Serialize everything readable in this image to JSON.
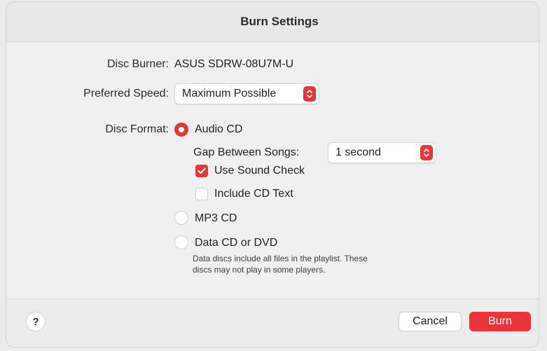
{
  "window": {
    "title": "Burn Settings"
  },
  "settings": {
    "disc_burner_label": "Disc Burner:",
    "disc_burner_value": "ASUS SDRW-08U7M-U",
    "preferred_speed_label": "Preferred Speed:",
    "preferred_speed_value": "Maximum Possible",
    "disc_format_label": "Disc Format:",
    "formats": [
      {
        "label": "Audio CD",
        "selected": true
      },
      {
        "label": "MP3 CD",
        "selected": false
      },
      {
        "label": "Data CD or DVD",
        "selected": false
      }
    ],
    "gap_label": "Gap Between Songs:",
    "gap_value": "1 second",
    "use_sound_check": {
      "label": "Use Sound Check",
      "checked": true
    },
    "include_cd_text": {
      "label": "Include CD Text",
      "checked": false
    },
    "data_note_line1": "Data discs include all files in the playlist. These",
    "data_note_line2": "discs may not play in some players."
  },
  "footer": {
    "help_label": "?",
    "cancel_label": "Cancel",
    "burn_label": "Burn"
  },
  "colors": {
    "accent": "#e8343a"
  },
  "icons": {
    "help": "question-mark-icon",
    "stepper": "updown-chevron-icon",
    "check": "checkmark-icon"
  }
}
